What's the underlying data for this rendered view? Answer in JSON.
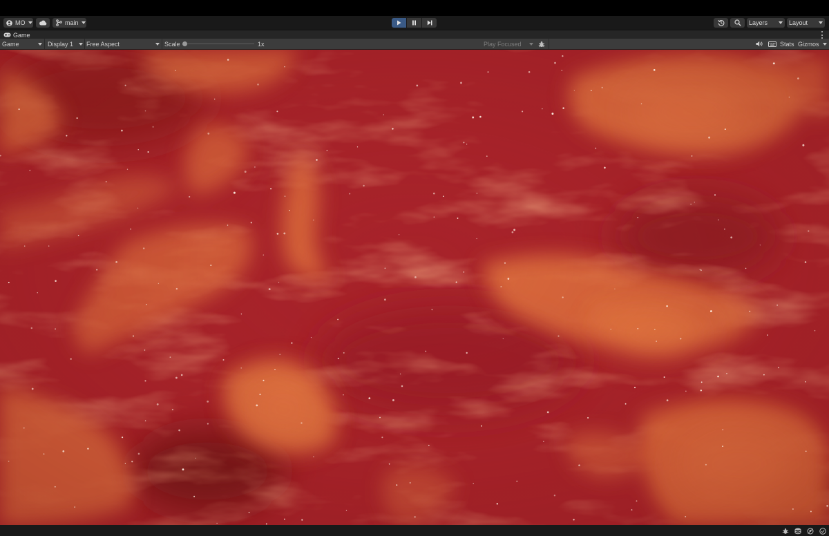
{
  "toolbar": {
    "account_label": "MO",
    "branch_label": "main",
    "layers_label": "Layers",
    "layout_label": "Layout",
    "icons": [
      "account-icon",
      "cloud-icon",
      "branch-icon",
      "play-icon",
      "pause-icon",
      "step-icon",
      "history-icon",
      "search-icon"
    ]
  },
  "tab": {
    "title": "Game"
  },
  "gamebar": {
    "view_mode": "Game",
    "display": "Display 1",
    "aspect": "Free Aspect",
    "scale_label": "Scale",
    "scale_value": "1x",
    "play_mode": "Play Focused",
    "stats_label": "Stats",
    "gizmos_label": "Gizmos"
  },
  "colors": {
    "nebula_base": "#a7232a",
    "nebula_dark": "#7e1518",
    "nebula_cloud": "#e2773f",
    "play_active": "#3a5a86"
  }
}
